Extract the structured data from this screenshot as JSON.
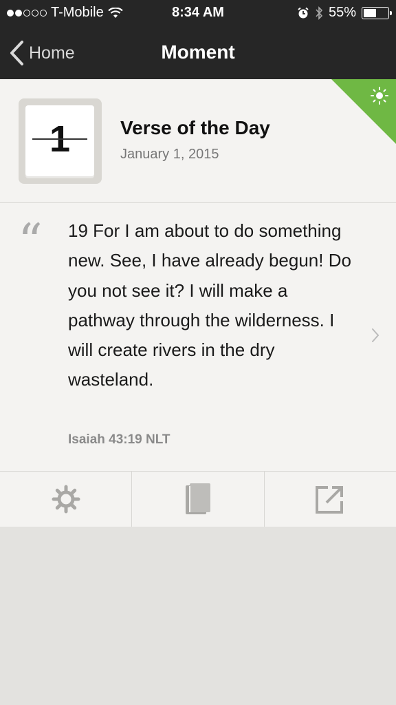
{
  "status_bar": {
    "carrier": "T-Mobile",
    "time": "8:34 AM",
    "battery_percent": "55%",
    "battery_level": 0.55,
    "signal_bars": 2,
    "icons": [
      "wifi-icon",
      "alarm-icon",
      "bluetooth-icon",
      "battery-icon"
    ]
  },
  "nav": {
    "back_label": "Home",
    "title": "Moment"
  },
  "moment": {
    "calendar_day": "1",
    "title": "Verse of the Day",
    "date": "January 1, 2015",
    "verse_text": "19 For I am about to do something new. See, I have already begun! Do you not see it? I will make a pathway through the wilderness. I will create rivers in the dry wasteland.",
    "reference": "Isaiah 43:19 NLT",
    "corner_icon": "sun-icon",
    "accent_color": "#6fb844"
  },
  "actions": [
    {
      "icon": "gear-icon"
    },
    {
      "icon": "book-icon"
    },
    {
      "icon": "share-icon"
    }
  ]
}
